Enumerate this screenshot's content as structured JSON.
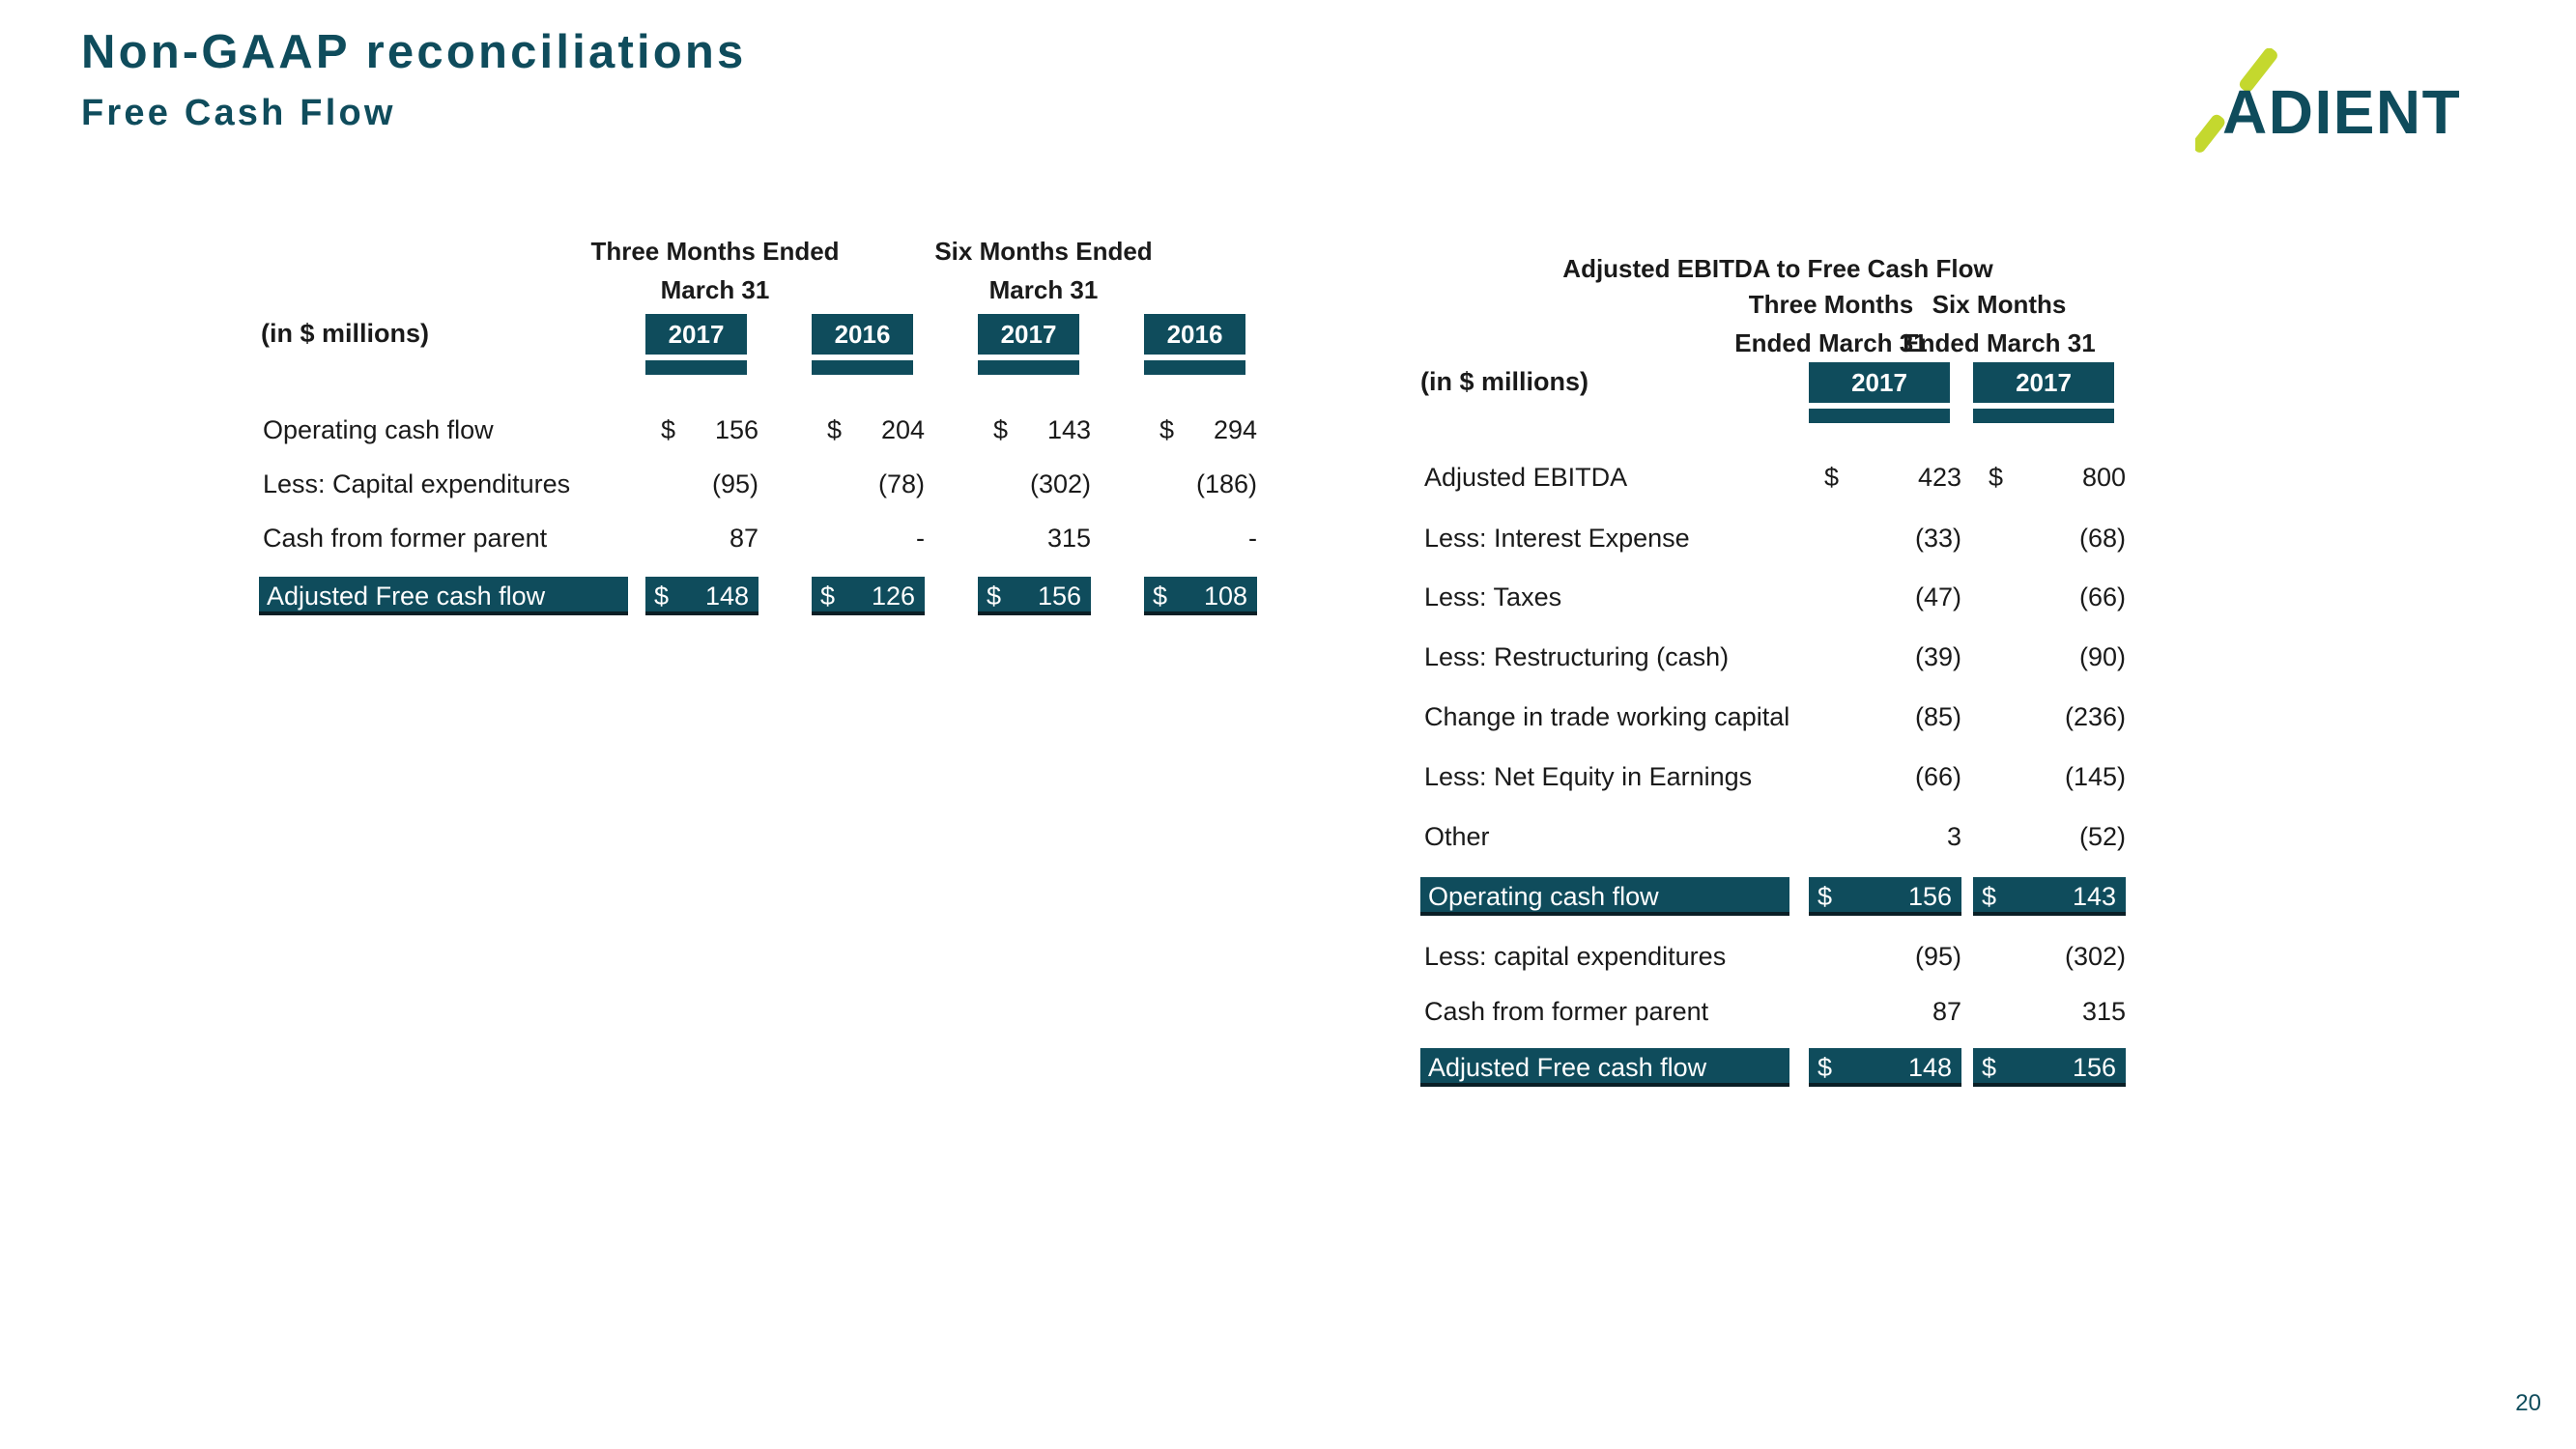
{
  "header": {
    "title": "Non-GAAP reconciliations",
    "subtitle": "Free Cash Flow",
    "logo_text": "ADIENT",
    "brand_teal": "#0f4c5c",
    "brand_lime": "#c4d82e"
  },
  "page_number": "20",
  "left_table": {
    "unit_label": "(in $ millions)",
    "group_headers": [
      {
        "line1": "Three Months Ended",
        "line2": "March 31"
      },
      {
        "line1": "Six Months Ended",
        "line2": "March 31"
      }
    ],
    "year_headers": [
      "2017",
      "2016",
      "2017",
      "2016"
    ],
    "rows": [
      {
        "label": "Operating cash flow",
        "highlight": false,
        "cells": [
          {
            "cur": "$",
            "val": "156"
          },
          {
            "cur": "$",
            "val": "204"
          },
          {
            "cur": "$",
            "val": "143"
          },
          {
            "cur": "$",
            "val": "294"
          }
        ]
      },
      {
        "label": "Less: Capital expenditures",
        "highlight": false,
        "cells": [
          {
            "cur": "",
            "val": "(95)"
          },
          {
            "cur": "",
            "val": "(78)"
          },
          {
            "cur": "",
            "val": "(302)"
          },
          {
            "cur": "",
            "val": "(186)"
          }
        ]
      },
      {
        "label": "Cash from former parent",
        "highlight": false,
        "cells": [
          {
            "cur": "",
            "val": "87"
          },
          {
            "cur": "",
            "val": "-"
          },
          {
            "cur": "",
            "val": "315"
          },
          {
            "cur": "",
            "val": "-"
          }
        ]
      },
      {
        "label": "Adjusted Free cash flow",
        "highlight": true,
        "cells": [
          {
            "cur": "$",
            "val": "148"
          },
          {
            "cur": "$",
            "val": "126"
          },
          {
            "cur": "$",
            "val": "156"
          },
          {
            "cur": "$",
            "val": "108"
          }
        ]
      }
    ]
  },
  "right_table": {
    "section_title": "Adjusted EBITDA to Free Cash Flow",
    "unit_label": "(in $ millions)",
    "group_headers": [
      {
        "line1": "Three Months",
        "line2": "Ended March 31"
      },
      {
        "line1": "Six Months",
        "line2": "Ended March 31"
      }
    ],
    "year_headers": [
      "2017",
      "2017"
    ],
    "rows": [
      {
        "label": "Adjusted EBITDA",
        "highlight": false,
        "cells": [
          {
            "cur": "$",
            "val": "423"
          },
          {
            "cur": "$",
            "val": "800"
          }
        ]
      },
      {
        "label": "Less: Interest Expense",
        "highlight": false,
        "cells": [
          {
            "cur": "",
            "val": "(33)"
          },
          {
            "cur": "",
            "val": "(68)"
          }
        ]
      },
      {
        "label": "Less: Taxes",
        "highlight": false,
        "cells": [
          {
            "cur": "",
            "val": "(47)"
          },
          {
            "cur": "",
            "val": "(66)"
          }
        ]
      },
      {
        "label": "Less: Restructuring (cash)",
        "highlight": false,
        "cells": [
          {
            "cur": "",
            "val": "(39)"
          },
          {
            "cur": "",
            "val": "(90)"
          }
        ]
      },
      {
        "label": "Change in trade working capital",
        "highlight": false,
        "cells": [
          {
            "cur": "",
            "val": "(85)"
          },
          {
            "cur": "",
            "val": "(236)"
          }
        ]
      },
      {
        "label": "Less: Net Equity in Earnings",
        "highlight": false,
        "cells": [
          {
            "cur": "",
            "val": "(66)"
          },
          {
            "cur": "",
            "val": "(145)"
          }
        ]
      },
      {
        "label": "Other",
        "highlight": false,
        "cells": [
          {
            "cur": "",
            "val": "3"
          },
          {
            "cur": "",
            "val": "(52)"
          }
        ]
      },
      {
        "label": "Operating cash flow",
        "highlight": true,
        "cells": [
          {
            "cur": "$",
            "val": "156"
          },
          {
            "cur": "$",
            "val": "143"
          }
        ]
      },
      {
        "label": "Less: capital expenditures",
        "highlight": false,
        "cells": [
          {
            "cur": "",
            "val": "(95)"
          },
          {
            "cur": "",
            "val": "(302)"
          }
        ]
      },
      {
        "label": "Cash from former parent",
        "highlight": false,
        "cells": [
          {
            "cur": "",
            "val": "87"
          },
          {
            "cur": "",
            "val": "315"
          }
        ]
      },
      {
        "label": "Adjusted Free cash flow",
        "highlight": true,
        "cells": [
          {
            "cur": "$",
            "val": "148"
          },
          {
            "cur": "$",
            "val": "156"
          }
        ]
      }
    ]
  }
}
